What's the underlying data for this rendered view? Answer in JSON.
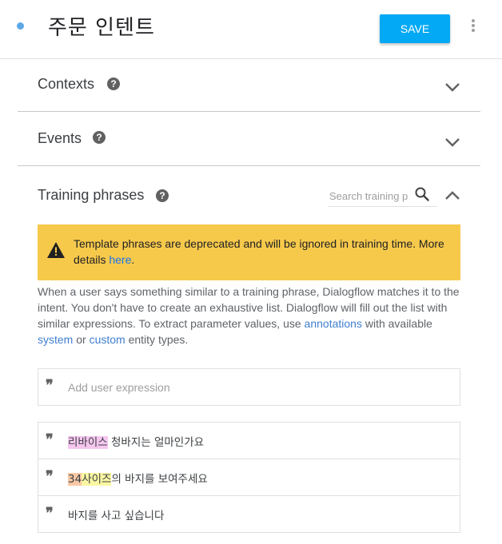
{
  "header": {
    "intent_name": "주문 인텐트",
    "save_label": "SAVE"
  },
  "sections": {
    "contexts": {
      "title": "Contexts"
    },
    "events": {
      "title": "Events"
    },
    "training": {
      "title": "Training phrases",
      "search_placeholder": "Search training p"
    }
  },
  "help_glyph": "?",
  "warning": {
    "text_before": "Template phrases are deprecated and will be ignored in training time. More details ",
    "link": "here",
    "text_after": "."
  },
  "description": {
    "part1": "When a user says something similar to a training phrase, Dialogflow matches it to the intent. You don't have to create an exhaustive list. Dialogflow will fill out the list with similar expressions. To extract parameter values, use ",
    "link_annotations": "annotations",
    "part2": " with available ",
    "link_system": "system",
    "part3": " or ",
    "link_custom": "custom",
    "part4": " entity types."
  },
  "add_expression": {
    "quote": "❞",
    "placeholder": "Add user expression"
  },
  "phrases": [
    {
      "seg1": "리바이스",
      "seg2": " 청바지는 얼마인가요"
    },
    {
      "seg1": "34",
      "seg2": "사이즈",
      "seg3": "의 바지를 보여주세요"
    },
    {
      "seg1": "바지를 사고 싶습니다"
    }
  ],
  "colors": {
    "accent": "#03a9f4",
    "warning_bg": "#f7c94b",
    "link": "#1a73e8",
    "annotation_pink": "#f6c6ef",
    "annotation_orange": "#f9c8a5",
    "annotation_yellow": "#fbf7a3"
  },
  "icons": [
    "status-dot",
    "more-vert-icon",
    "help-icon",
    "chevron-down-icon",
    "chevron-up-icon",
    "search-icon",
    "warning-icon",
    "quote-icon"
  ]
}
